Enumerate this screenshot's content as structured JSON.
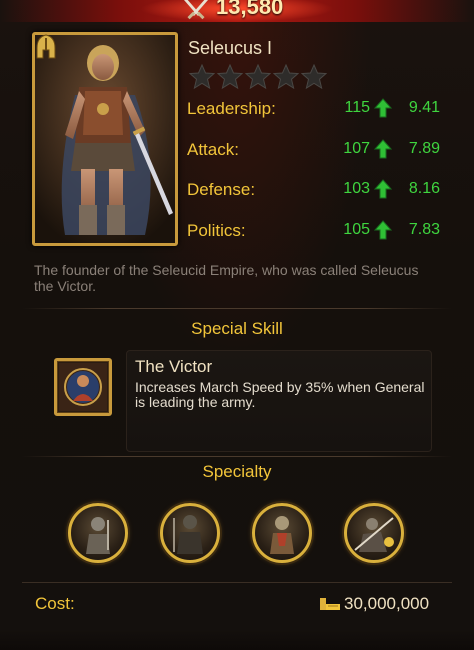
{
  "header": {
    "power_value": "13,580",
    "power_icon": "crossed-swords-icon"
  },
  "general": {
    "name": "Seleucus I",
    "stars_total": 5,
    "stars_filled": 0,
    "type_icon": "helmet-icon",
    "stats": [
      {
        "label": "Leadership:",
        "value": "115",
        "growth": "9.41"
      },
      {
        "label": "Attack:",
        "value": "107",
        "growth": "7.89"
      },
      {
        "label": "Defense:",
        "value": "103",
        "growth": "8.16"
      },
      {
        "label": "Politics:",
        "value": "105",
        "growth": "7.83"
      }
    ],
    "description": "The founder of the Seleucid Empire, who was called Seleucus the Victor."
  },
  "special_skill": {
    "section_title": "Special Skill",
    "name": "The Victor",
    "description": "Increases March Speed by 35% when General is leading the army."
  },
  "specialty": {
    "section_title": "Specialty",
    "items": [
      "infantry-specialty-icon",
      "cavalry-specialty-icon",
      "archer-specialty-icon",
      "siege-specialty-icon"
    ]
  },
  "cost": {
    "label": "Cost:",
    "value": "30,000,000",
    "icon": "gold-icon"
  },
  "colors": {
    "accent_gold": "#f2c53a",
    "stat_green": "#3fd53f",
    "frame_gold": "#c89a3c"
  }
}
